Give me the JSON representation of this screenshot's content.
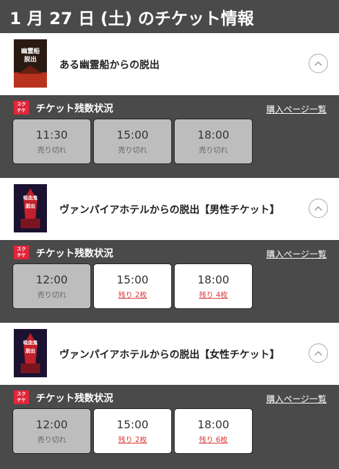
{
  "header": {
    "title": "1 月 27 日 (土) のチケット情報"
  },
  "stock_label": "チケット残数状況",
  "buy_link": "購入ページ一覧",
  "logo_text": [
    "スク",
    "チケ"
  ],
  "events": [
    {
      "title": "ある幽霊船からの脱出",
      "poster_text": "幽霊船 脱出",
      "slots": [
        {
          "time": "11:30",
          "status": "売り切れ",
          "sold": true
        },
        {
          "time": "15:00",
          "status": "売り切れ",
          "sold": true
        },
        {
          "time": "18:00",
          "status": "売り切れ",
          "sold": true
        }
      ]
    },
    {
      "title": "ヴァンパイアホテルからの脱出【男性チケット】",
      "poster_text": "吸血鬼 脱出",
      "slots": [
        {
          "time": "12:00",
          "status": "売り切れ",
          "sold": true
        },
        {
          "time": "15:00",
          "status": "残り 2枚",
          "sold": false
        },
        {
          "time": "18:00",
          "status": "残り 4枚",
          "sold": false
        }
      ]
    },
    {
      "title": "ヴァンパイアホテルからの脱出【女性チケット】",
      "poster_text": "吸血鬼 脱出",
      "slots": [
        {
          "time": "12:00",
          "status": "売り切れ",
          "sold": true
        },
        {
          "time": "15:00",
          "status": "残り 2枚",
          "sold": false
        },
        {
          "time": "18:00",
          "status": "残り 6枚",
          "sold": false
        }
      ]
    }
  ]
}
